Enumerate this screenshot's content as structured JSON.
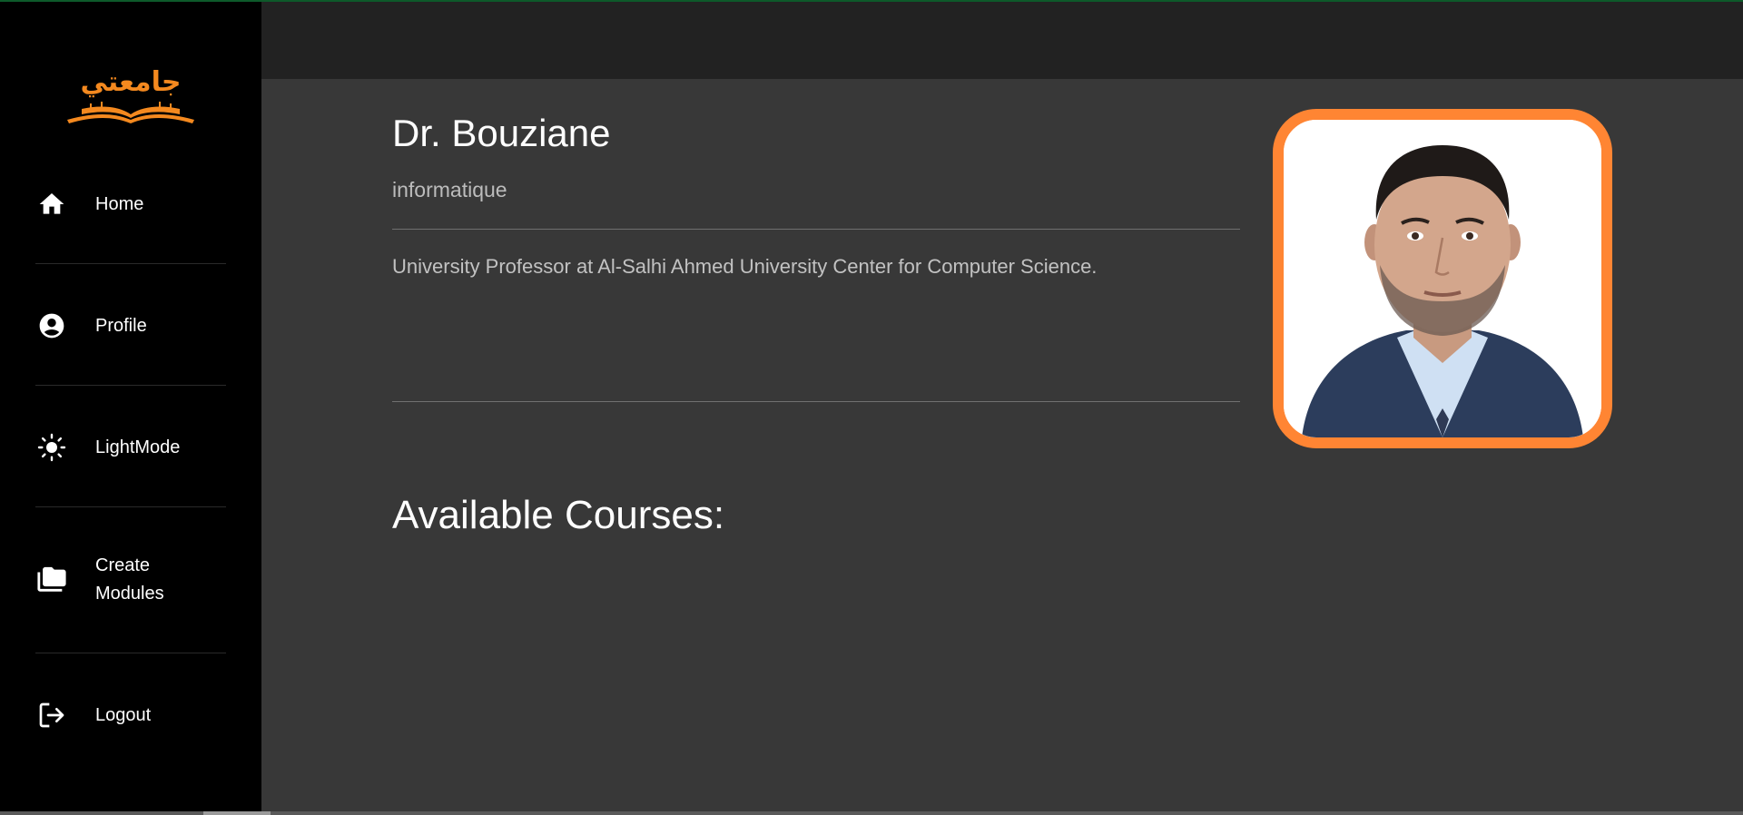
{
  "brand": {
    "logo_text": "جامعتي",
    "logo_color": "#f4891f"
  },
  "sidebar": {
    "items": [
      {
        "label": "Home",
        "icon": "home-icon"
      },
      {
        "label": "Profile",
        "icon": "account-circle-icon"
      },
      {
        "label": "LightMode",
        "icon": "sun-icon"
      },
      {
        "label_line1": "Create",
        "label_line2": "Modules",
        "icon": "folders-icon"
      },
      {
        "label": "Logout",
        "icon": "logout-icon"
      }
    ]
  },
  "profile": {
    "name": "Dr. Bouziane",
    "department": "informatique",
    "bio": "University Professor at Al-Salhi Ahmed University Center for Computer Science.",
    "photo_border_color": "#ff8533"
  },
  "courses": {
    "heading": "Available Courses:"
  },
  "colors": {
    "sidebar_bg": "#000000",
    "topbar_bg": "#222222",
    "content_bg": "#383838",
    "accent": "#ff8533"
  }
}
